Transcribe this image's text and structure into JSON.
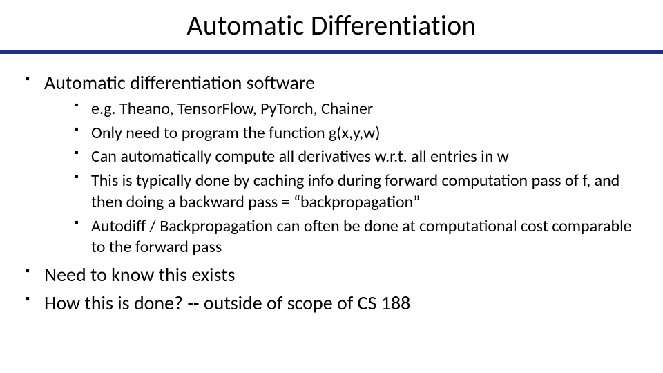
{
  "title": "Automatic Differentiation",
  "bullets": {
    "b0": {
      "text": "Automatic differentiation software",
      "sub": [
        "e.g. Theano, TensorFlow, PyTorch, Chainer",
        "Only need to program the function g(x,y,w)",
        "Can automatically compute all derivatives w.r.t. all entries in w",
        "This is typically done by caching info during forward computation pass of f, and then doing a backward pass = “backpropagation”",
        "Autodiff / Backpropagation can often be done at computational cost comparable to the forward pass"
      ]
    },
    "b1": {
      "text": "Need to know this exists"
    },
    "b2": {
      "text": "How this is done?  --  outside of scope of CS 188"
    }
  }
}
